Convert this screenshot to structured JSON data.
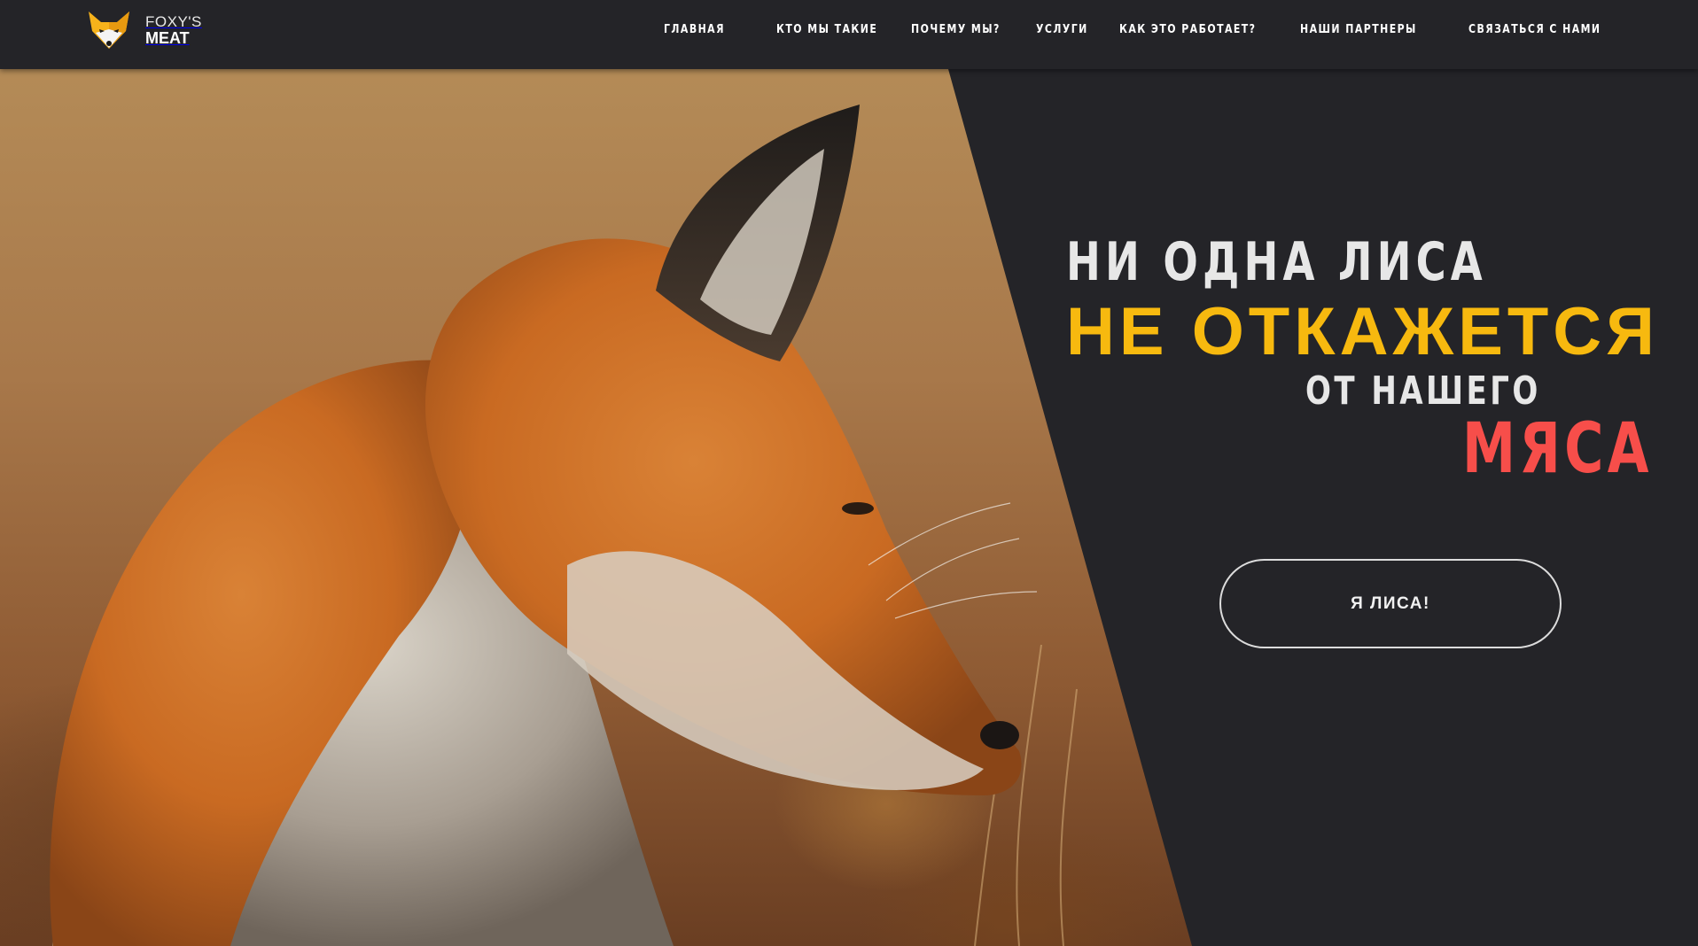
{
  "brand": {
    "name_top": "FOXY'S",
    "name_bottom": "MEAT",
    "icon": "fox-logo-icon"
  },
  "nav": {
    "items": [
      {
        "label": "ГЛАВНАЯ"
      },
      {
        "label": "КТО МЫ ТАКИЕ"
      },
      {
        "label": "ПОЧЕМУ МЫ?"
      },
      {
        "label": "УСЛУГИ"
      },
      {
        "label": "КАК ЭТО РАБОТАЕТ?"
      },
      {
        "label": "НАШИ ПАРТНЕРЫ"
      },
      {
        "label": "СВЯЗАТЬСЯ С НАМИ"
      }
    ]
  },
  "hero": {
    "line1": "НИ ОДНА ЛИСА",
    "line2": "НЕ ОТКАЖЕТСЯ",
    "line3": "ОТ НАШЕГО",
    "line4": "МЯСА",
    "cta_label": "Я ЛИСА!",
    "image": "red fox in profile"
  },
  "colors": {
    "background": "#242428",
    "accent_yellow": "#f7b90f",
    "accent_red": "#f74e4a",
    "text_light": "#e7e7e7"
  }
}
